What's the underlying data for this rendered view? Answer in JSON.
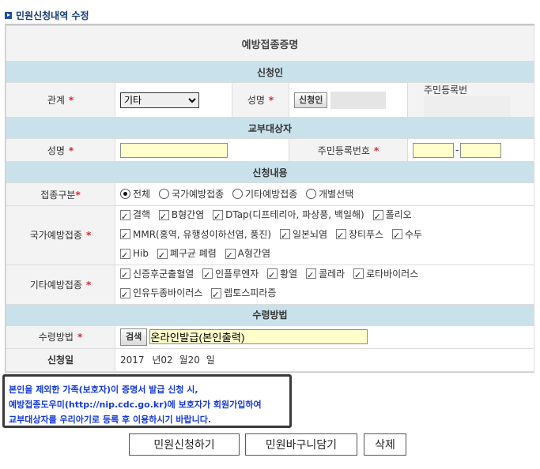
{
  "page_title": "민원신청내역 수정",
  "form": {
    "main_title": "예방접종증명",
    "sections": {
      "applicant": "신청인",
      "recipient": "교부대상자",
      "content": "신청내용",
      "receipt": "수령방법"
    },
    "applicant": {
      "relation_label": "관계",
      "relation_value": "기타",
      "name_label": "성명",
      "name_button": "신청인",
      "id_label": "주민등록번"
    },
    "recipient": {
      "name_label": "성명",
      "id_label": "주민등록번호",
      "id_separator": "-"
    },
    "content": {
      "type_label": "접종구분",
      "type_options": [
        {
          "label": "전체",
          "selected": true
        },
        {
          "label": "국가예방접종",
          "selected": false
        },
        {
          "label": "기타예방접종",
          "selected": false
        },
        {
          "label": "개별선택",
          "selected": false
        }
      ],
      "national_label": "국가예방접종",
      "national_items": [
        "결핵",
        "B형간염",
        "DTap(디프테리아, 파상풍, 백일해)",
        "폴리오",
        "MMR(홍역, 유행성이하선염, 풍진)",
        "일본뇌염",
        "장티푸스",
        "수두",
        "Hib",
        "폐구균 폐렴",
        "A형간염"
      ],
      "other_label": "기타예방접종",
      "other_items": [
        "신증후군출혈열",
        "인플루엔자",
        "황열",
        "콜레라",
        "로타바이러스",
        "인유두종바이러스",
        "렙토스피라증"
      ]
    },
    "receipt": {
      "method_label": "수령방법",
      "search_button": "검색",
      "method_value": "온라인발급(본인출력)",
      "date_label": "신청일",
      "date_year": "2017",
      "date_year_unit": "년",
      "date_month": "02",
      "date_month_unit": "월",
      "date_day": "20",
      "date_day_unit": "일"
    }
  },
  "notice": {
    "line1": "본인을 제외한 가족(보호자)이 증명서 발급 신청 시,",
    "line2": "예방접종도우미(http://nip.cdc.go.kr)에 보호자가 회원가입하여",
    "line3": "교부대상자를 우리아기로 등록 후 이용하시기 바랍니다."
  },
  "buttons": {
    "submit": "민원신청하기",
    "basket": "민원바구니담기",
    "delete": "삭제"
  },
  "required_mark": "*",
  "colors": {
    "section_bg": "#c9e1ea",
    "required": "#d8262b",
    "notice_text": "#1439d8",
    "input_bg": "#ffffcc"
  }
}
